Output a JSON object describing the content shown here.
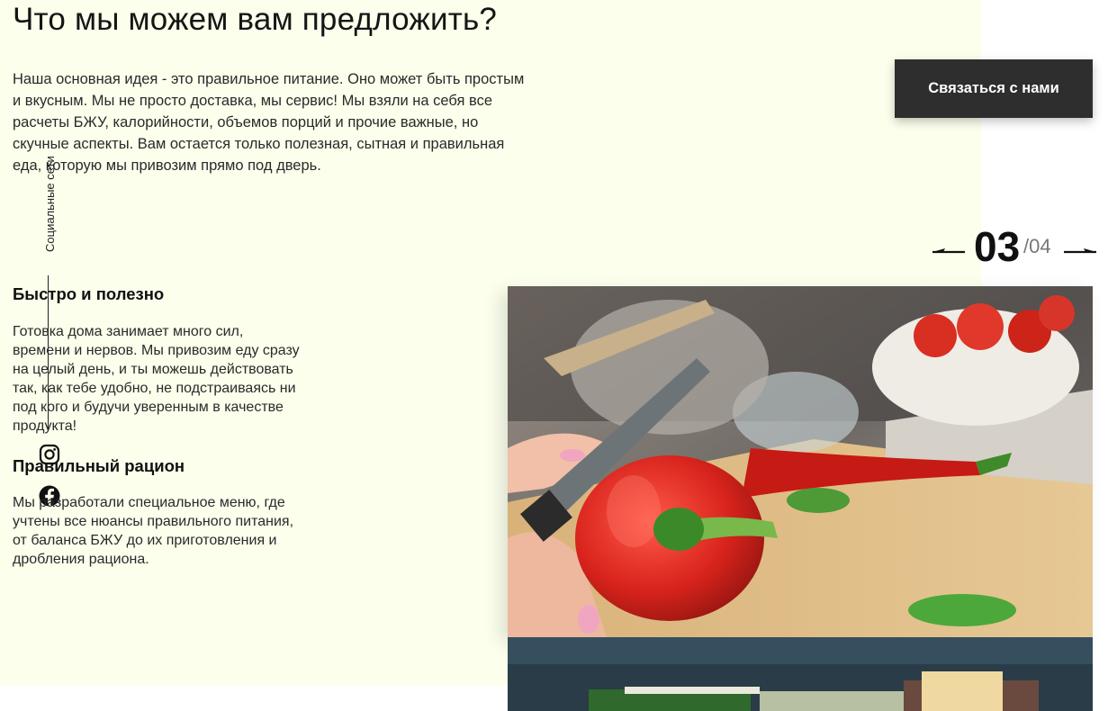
{
  "section": {
    "title": "Что мы можем вам предложить?",
    "intro": "Наша основная идея - это правильное питание. Оно может быть простым и вкусным. Мы не просто доставка, мы сервис! Мы взяли на себя все расчеты БЖУ, калорийности, объемов порций и прочие важные, но скучные аспекты. Вам остается только полезная, сытная и правильная еда, которую мы привозим прямо под дверь."
  },
  "cta": {
    "label": "Связаться с нами"
  },
  "social": {
    "label": "Социальные сети",
    "icons": [
      "instagram-icon",
      "facebook-icon"
    ]
  },
  "slider": {
    "current": "03",
    "total": "/04"
  },
  "features": [
    {
      "title": "Быстро и полезно",
      "text": "Готовка дома занимает много сил, времени и нервов. Мы привозим еду сразу на целый день, и ты можешь действовать так, как тебе удобно, не подстраиваясь ни под кого и будучи уверенным в качестве продукта!"
    },
    {
      "title": "Правильный рацион",
      "text": "Мы разработали специальное меню, где учтены все нюансы правильного питания, от баланса БЖУ до их приготовления и дробления рациона."
    }
  ],
  "colors": {
    "panel_bg": "#fbffec",
    "button_bg": "#2e2e2e",
    "button_text": "#ffffff",
    "accent_red": "#d8231c"
  }
}
